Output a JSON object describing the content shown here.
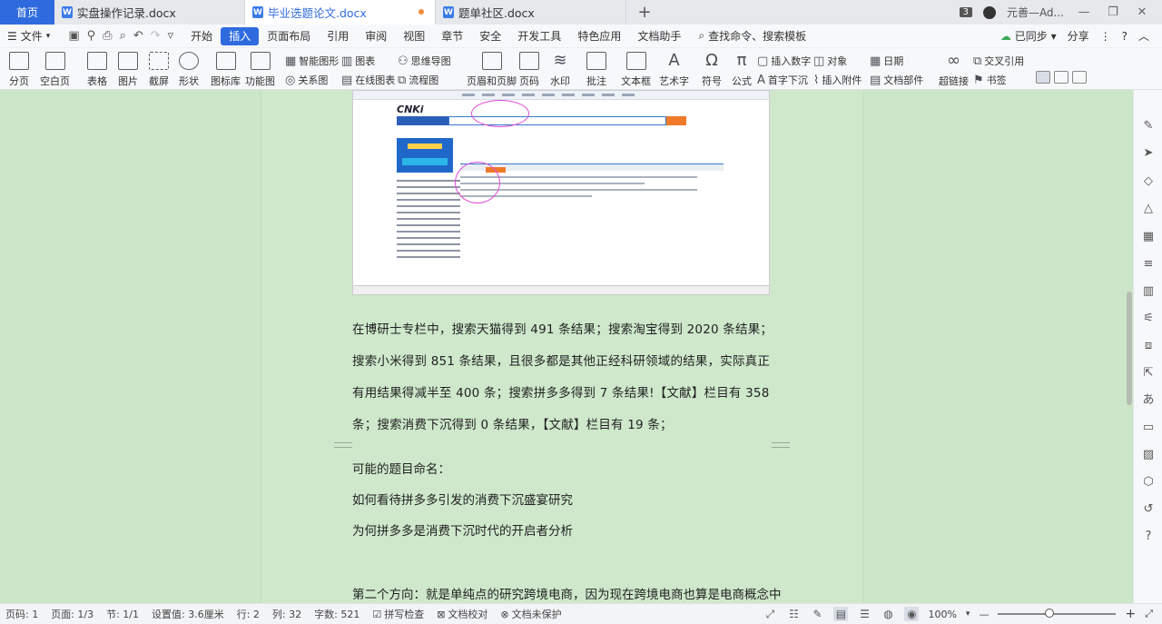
{
  "tabs": {
    "home": "首页",
    "items": [
      {
        "label": "实盘操作记录.docx",
        "active": false,
        "modified": false
      },
      {
        "label": "毕业选题论文.docx",
        "active": true,
        "modified": true
      },
      {
        "label": "题单社区.docx",
        "active": false,
        "modified": false
      }
    ],
    "window_count": "3",
    "user": "元善—Ad..."
  },
  "menu": {
    "file": "文件",
    "items": [
      "开始",
      "插入",
      "页面布局",
      "引用",
      "审阅",
      "视图",
      "章节",
      "安全",
      "开发工具",
      "特色应用",
      "文档助手"
    ],
    "active": "插入",
    "search": "查找命令、搜索模板",
    "sync": "已同步",
    "share": "分享"
  },
  "ribbon": {
    "page_break": "分页",
    "blank_page": "空白页",
    "table": "表格",
    "picture": "图片",
    "screenshot": "截屏",
    "shape": "形状",
    "icon_lib": "图标库",
    "function_chart": "功能图",
    "smart_shape": "智能图形",
    "chart": "图表",
    "relation_chart": "关系图",
    "online_chart": "在线图表",
    "mind_map": "思维导图",
    "flow_chart": "流程图",
    "header_footer": "页眉和页脚",
    "page_number": "页码",
    "watermark": "水印",
    "comment": "批注",
    "text_box": "文本框",
    "art_text": "艺术字",
    "symbol": "符号",
    "formula": "公式",
    "insert_number": "插入数字",
    "object": "对象",
    "drop_cap": "首字下沉",
    "insert_attachment": "插入附件",
    "date": "日期",
    "doc_parts": "文档部件",
    "hyperlink": "超链接",
    "cross_ref": "交叉引用",
    "bookmark": "书签"
  },
  "document": {
    "paragraph1": "在博研士专栏中，搜索天猫得到 491 条结果；搜索淘宝得到 2020 条结果；搜索小米得到 851 条结果，且很多都是其他正经科研领域的结果，实际真正有用结果得减半至 400 条；搜索拼多多得到 7 条结果!【文献】栏目有 358 条；搜索消费下沉得到 0 条结果，【文献】栏目有 19 条；",
    "line_titles_heading": "可能的题目命名：",
    "title1": "如何看待拼多多引发的消费下沉盛宴研究",
    "title2": "为何拼多多是消费下沉时代的开启者分析",
    "paragraph2": "第二个方向：就是单纯点的研究跨境电商，因为现在跨境电商也算是电商概念中"
  },
  "statusbar": {
    "page_num": "页码: 1",
    "pages": "页面: 1/3",
    "section": "节: 1/1",
    "setting": "设置值: 3.6厘米",
    "row": "行: 2",
    "col": "列: 32",
    "word_count": "字数: 521",
    "spell_check": "拼写检查",
    "doc_proof": "文档校对",
    "doc_unprotected": "文档未保护",
    "zoom": "100%"
  }
}
